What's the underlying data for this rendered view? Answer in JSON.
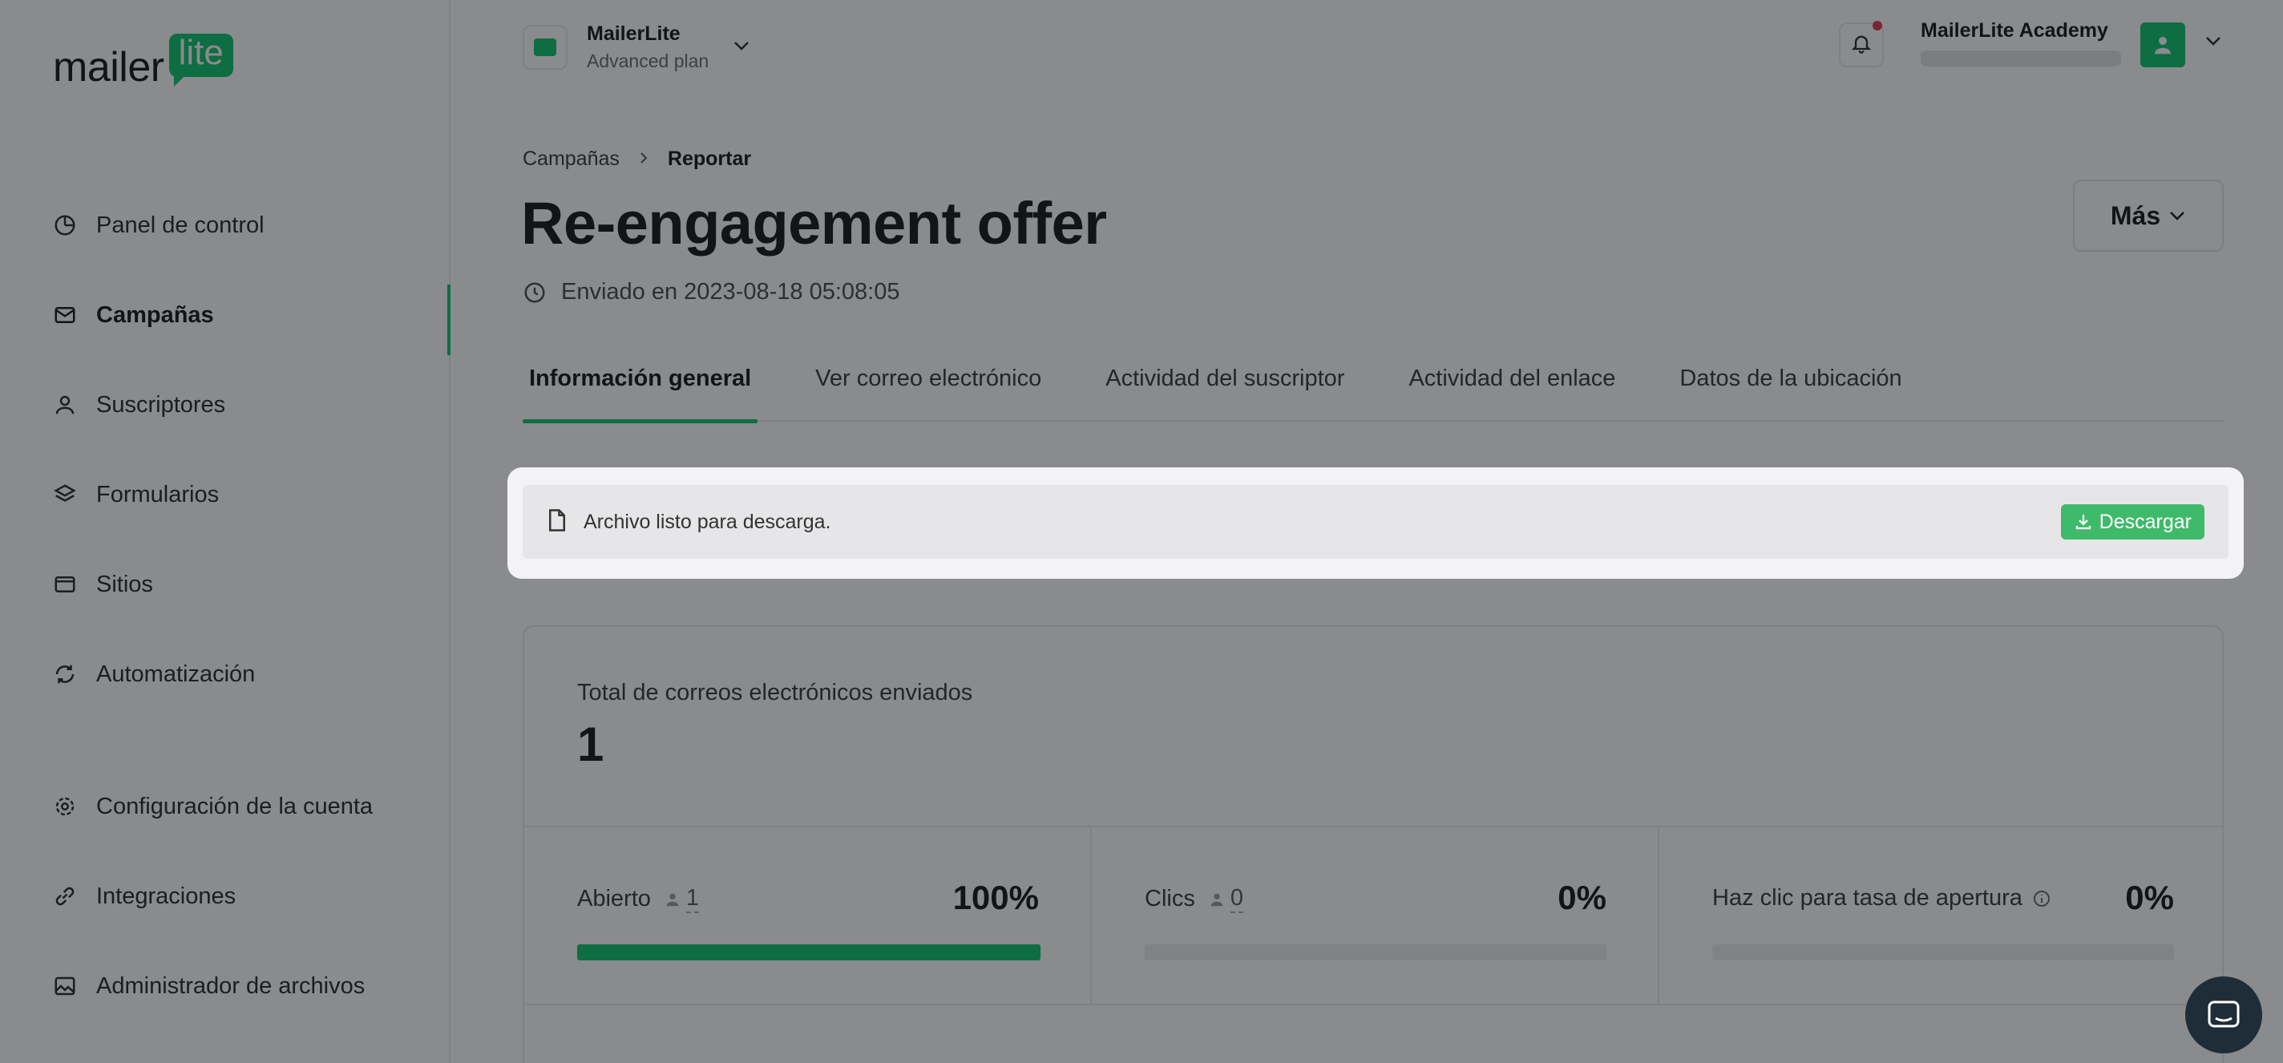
{
  "brand": {
    "logo_word": "mailer",
    "logo_badge": "lite",
    "accent": "#09c269"
  },
  "sidebar": {
    "items": [
      {
        "label": "Panel de control",
        "icon": "clock-icon"
      },
      {
        "label": "Campañas",
        "icon": "mail-icon",
        "active": true
      },
      {
        "label": "Suscriptores",
        "icon": "user-icon"
      },
      {
        "label": "Formularios",
        "icon": "layers-icon"
      },
      {
        "label": "Sitios",
        "icon": "browser-icon"
      },
      {
        "label": "Automatización",
        "icon": "refresh-icon"
      }
    ],
    "bottom_items": [
      {
        "label": "Configuración de la cuenta",
        "icon": "gear-icon"
      },
      {
        "label": "Integraciones",
        "icon": "link-icon"
      },
      {
        "label": "Administrador de archivos",
        "icon": "image-icon"
      }
    ]
  },
  "topbar": {
    "account_name": "MailerLite",
    "account_plan": "Advanced plan",
    "user_name": "MailerLite Academy"
  },
  "header": {
    "breadcrumb": [
      "Campañas",
      "Reportar"
    ],
    "title": "Re-engagement offer",
    "sent_text": "Enviado en 2023-08-18 05:08:05",
    "more_button": "Más"
  },
  "tabs": [
    {
      "label": "Información general",
      "active": true
    },
    {
      "label": "Ver correo electrónico"
    },
    {
      "label": "Actividad del suscriptor"
    },
    {
      "label": "Actividad del enlace"
    },
    {
      "label": "Datos de la ubicación"
    }
  ],
  "banner": {
    "text": "Archivo listo para descarga.",
    "button": "Descargar"
  },
  "stats": {
    "total_label": "Total de correos electrónicos enviados",
    "total_value": "1",
    "items": [
      {
        "label": "Abierto",
        "count": "1",
        "percent": "100%",
        "fill": 1.0
      },
      {
        "label": "Clics",
        "count": "0",
        "percent": "0%",
        "fill": 0.0
      },
      {
        "label": "Haz clic para tasa de apertura",
        "count": "",
        "percent": "0%",
        "fill": 0.0
      }
    ]
  }
}
